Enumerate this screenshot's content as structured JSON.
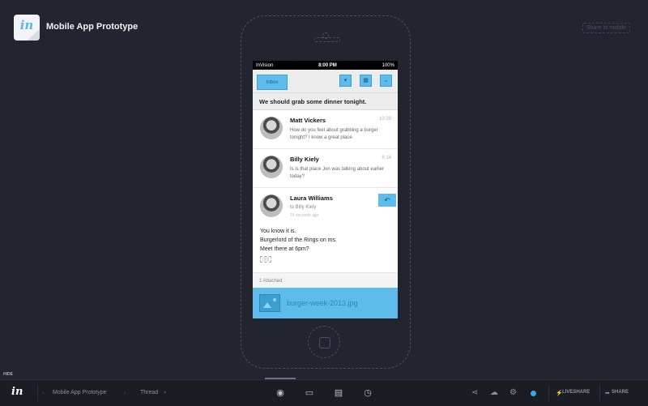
{
  "header": {
    "logo_text": "in",
    "title": "Mobile App Prototype",
    "share_mobile": "Share to mobile"
  },
  "statusbar": {
    "carrier": "InVision",
    "time": "8:00 PM",
    "battery": "100%"
  },
  "navbar": {
    "inbox_label": "Inbox"
  },
  "thread": {
    "subject": "We should grab some dinner tonight.",
    "messages": [
      {
        "name": "Matt Vickers",
        "timestamp": "10:39",
        "preview": "How do you feel about grabbing a burger tonight? I know a great place."
      },
      {
        "name": "Billy Kiely",
        "timestamp": "6:14",
        "preview": "Is is that place Jon was talking about earlier today?"
      }
    ],
    "open_message": {
      "name": "Laura Williams",
      "to": "to Billy Kiely",
      "ago": "15 seconds ago",
      "body_line1": "You know it is.",
      "body_line2": "Burgerlord of the Rings on ms.",
      "body_line3": "Meet there at 6pm?",
      "sig": "▯▯▯"
    },
    "attached_label": "1 Attached",
    "attachment_name": "burger-week-2013.jpg"
  },
  "bottombar": {
    "hide_label": "HIDE",
    "logo_text": "in",
    "crumb_project": "Mobile App Prototype",
    "crumb_screen": "Thread",
    "liveshare": "LIVESHARE",
    "share": "SHARE"
  },
  "colors": {
    "background": "#22252f",
    "accent": "#5dbcec"
  }
}
